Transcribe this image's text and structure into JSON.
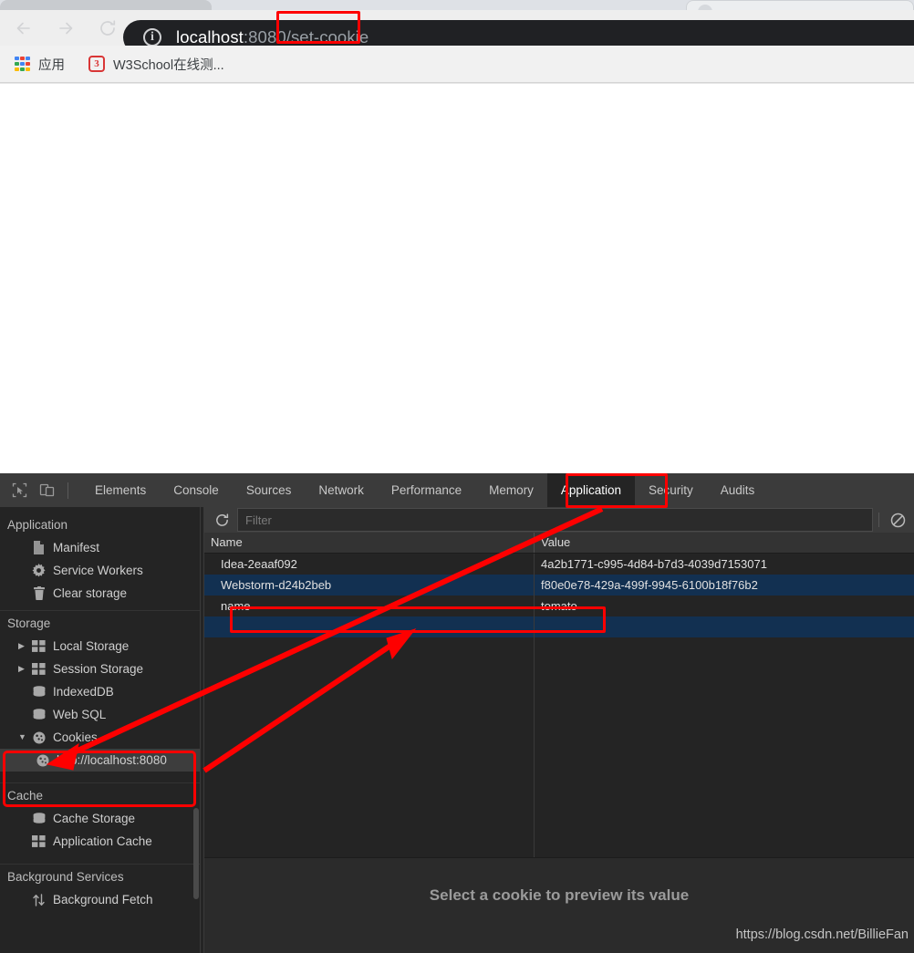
{
  "browser": {
    "nav": {
      "back_label": "Back",
      "forward_label": "Forward",
      "reload_label": "Reload"
    },
    "omnibox": {
      "site_info_glyph": "i",
      "url_host": "localhost",
      "url_path": ":8080/set-cookie",
      "url_full": "localhost:8080/set-cookie"
    },
    "bookmarks": [
      {
        "label": "应用",
        "icon": "apps-grid-icon"
      },
      {
        "label": "W3School在线测...",
        "icon": "w3school-icon"
      }
    ]
  },
  "devtools": {
    "tool_icons": [
      {
        "name": "inspect-element-icon"
      },
      {
        "name": "device-toolbar-icon"
      }
    ],
    "tabs": [
      {
        "label": "Elements",
        "active": false
      },
      {
        "label": "Console",
        "active": false
      },
      {
        "label": "Sources",
        "active": false
      },
      {
        "label": "Network",
        "active": false
      },
      {
        "label": "Performance",
        "active": false
      },
      {
        "label": "Memory",
        "active": false
      },
      {
        "label": "Application",
        "active": true
      },
      {
        "label": "Security",
        "active": false
      },
      {
        "label": "Audits",
        "active": false
      }
    ],
    "sidebar": {
      "groups": [
        {
          "title": "Application",
          "items": [
            {
              "label": "Manifest",
              "icon": "document-icon",
              "indent": 1,
              "arrow": "",
              "selected": false
            },
            {
              "label": "Service Workers",
              "icon": "gear-icon",
              "indent": 1,
              "arrow": "",
              "selected": false
            },
            {
              "label": "Clear storage",
              "icon": "trash-icon",
              "indent": 1,
              "arrow": "",
              "selected": false
            }
          ]
        },
        {
          "title": "Storage",
          "items": [
            {
              "label": "Local Storage",
              "icon": "table-icon",
              "indent": 1,
              "arrow": "▶",
              "selected": false
            },
            {
              "label": "Session Storage",
              "icon": "table-icon",
              "indent": 1,
              "arrow": "▶",
              "selected": false
            },
            {
              "label": "IndexedDB",
              "icon": "database-icon",
              "indent": 1,
              "arrow": "",
              "selected": false
            },
            {
              "label": "Web SQL",
              "icon": "database-icon",
              "indent": 1,
              "arrow": "",
              "selected": false
            },
            {
              "label": "Cookies",
              "icon": "cookie-icon",
              "indent": 1,
              "arrow": "▼",
              "selected": false
            },
            {
              "label": "http://localhost:8080",
              "icon": "cookie-icon",
              "indent": 2,
              "arrow": "",
              "selected": true
            }
          ]
        },
        {
          "title": "Cache",
          "items": [
            {
              "label": "Cache Storage",
              "icon": "database-icon",
              "indent": 1,
              "arrow": "",
              "selected": false
            },
            {
              "label": "Application Cache",
              "icon": "table-icon",
              "indent": 1,
              "arrow": "",
              "selected": false
            }
          ]
        },
        {
          "title": "Background Services",
          "items": [
            {
              "label": "Background Fetch",
              "icon": "updown-arrows-icon",
              "indent": 1,
              "arrow": "",
              "selected": false
            }
          ]
        }
      ]
    },
    "cookie_panel": {
      "refresh_icon": "refresh-icon",
      "clear_icon": "clear-all-cookies-icon",
      "filter_placeholder": "Filter",
      "filter_value": "",
      "columns": [
        "Name",
        "Value"
      ],
      "rows": [
        {
          "name": "Idea-2eaaf092",
          "value": "4a2b1771-c995-4d84-b7d3-4039d7153071",
          "striped": false
        },
        {
          "name": "Webstorm-d24b2beb",
          "value": "f80e0e78-429a-499f-9945-6100b18f76b2",
          "striped": true
        },
        {
          "name": "name",
          "value": "tomato",
          "striped": false
        },
        {
          "name": "",
          "value": "",
          "striped": true
        }
      ],
      "detail_placeholder": "Select a cookie to preview its value"
    },
    "watermark": "https://blog.csdn.net/BillieFan"
  },
  "annotations": {
    "color": "#fe0000",
    "boxes": [
      {
        "name": "highlight-url-set-cookie"
      },
      {
        "name": "highlight-application-tab"
      },
      {
        "name": "highlight-cookies-origin"
      },
      {
        "name": "highlight-cookie-name-row"
      }
    ],
    "arrows": [
      {
        "name": "arrow-application-tab-to-cookies-origin"
      },
      {
        "name": "arrow-cookies-origin-to-name-row"
      }
    ]
  }
}
